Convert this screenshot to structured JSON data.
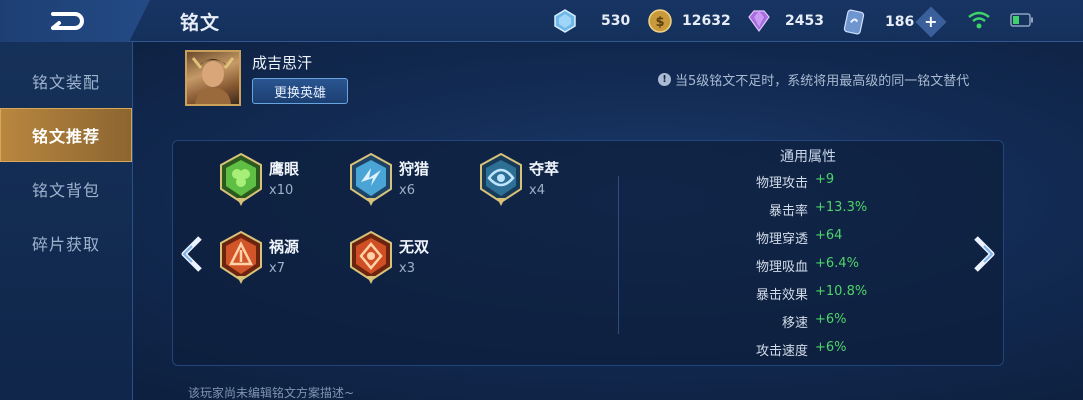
{
  "header": {
    "title": "铭文",
    "resources": [
      {
        "icon": "diamond-crystal-icon",
        "value": "530"
      },
      {
        "icon": "gold-coin-icon",
        "value": "12632"
      },
      {
        "icon": "purple-gem-icon",
        "value": "2453"
      },
      {
        "icon": "voucher-icon",
        "value": "186"
      }
    ]
  },
  "sidebar": {
    "items": [
      {
        "label": "铭文装配",
        "active": false
      },
      {
        "label": "铭文推荐",
        "active": true
      },
      {
        "label": "铭文背包",
        "active": false
      },
      {
        "label": "碎片获取",
        "active": false
      }
    ]
  },
  "hero": {
    "name": "成吉思汗",
    "change_label": "更换英雄"
  },
  "notice": "当5级铭文不足时，系统将用最高级的同一铭文替代",
  "runes": [
    {
      "name": "鹰眼",
      "count": "x10",
      "color": "#4fae3a"
    },
    {
      "name": "狩猎",
      "count": "x6",
      "color": "#3f94c9"
    },
    {
      "name": "夺萃",
      "count": "x4",
      "color": "#3a8fb6"
    },
    {
      "name": "祸源",
      "count": "x7",
      "color": "#d0502a"
    },
    {
      "name": "无双",
      "count": "x3",
      "color": "#d0502a"
    }
  ],
  "attributes": {
    "title": "通用属性",
    "rows": [
      {
        "label": "物理攻击",
        "value": "+9"
      },
      {
        "label": "暴击率",
        "value": "+13.3%"
      },
      {
        "label": "物理穿透",
        "value": "+64"
      },
      {
        "label": "物理吸血",
        "value": "+6.4%"
      },
      {
        "label": "暴击效果",
        "value": "+10.8%"
      },
      {
        "label": "移速",
        "value": "+6%"
      },
      {
        "label": "攻击速度",
        "value": "+6%"
      }
    ]
  },
  "footer_note": "该玩家尚未编辑铭文方案描述~"
}
